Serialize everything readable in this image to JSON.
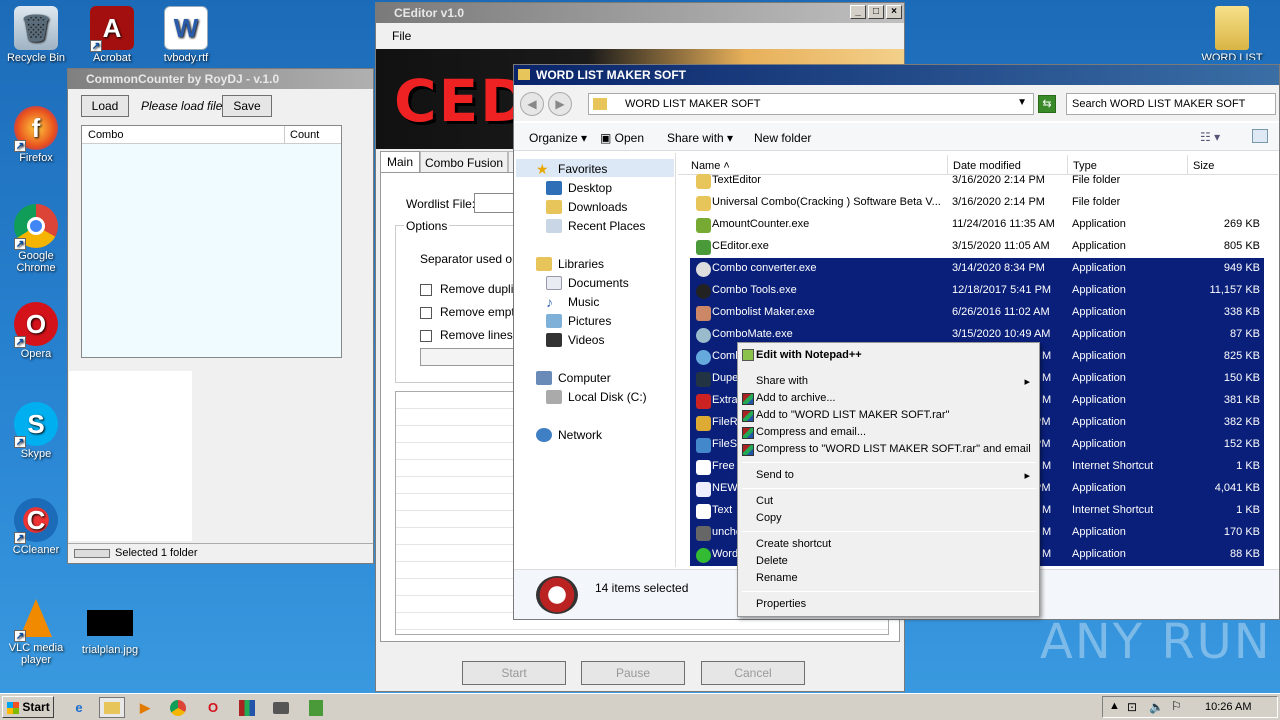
{
  "desktop": {
    "icons": [
      {
        "label": "Recycle Bin"
      },
      {
        "label": "Acrobat"
      },
      {
        "label": "tvbody.rtf"
      },
      {
        "label": "Firefox"
      },
      {
        "label": "Google Chrome"
      },
      {
        "label": "Opera"
      },
      {
        "label": "Skype"
      },
      {
        "label": "CCleaner"
      },
      {
        "label": "VLC media player"
      },
      {
        "label": "trialplan.jpg"
      },
      {
        "label": "WORD LIST ..."
      }
    ],
    "watermark": "ANY RUN"
  },
  "common_counter": {
    "title": "CommonCounter by RoyDJ - v.1.0",
    "load_label": "Load",
    "status_text": "Please load file",
    "save_label": "Save",
    "columns": [
      "Combo",
      "Count"
    ],
    "statusbar": "Selected 1 folder"
  },
  "ceditor": {
    "title": "CEditor v1.0",
    "menu_file": "File",
    "banner_text": "CED",
    "tabs": [
      "Main",
      "Combo Fusion",
      "D"
    ],
    "wordlist_label": "Wordlist File:",
    "options_label": "Options",
    "separator_label": "Separator used on c",
    "checks": [
      "Remove duplica",
      "Remove empty",
      "Remove lines w"
    ],
    "start_label": "Start",
    "pause_label": "Pause",
    "cancel_label": "Cancel"
  },
  "explorer": {
    "title": "WORD LIST MAKER SOFT",
    "address": "WORD LIST MAKER SOFT",
    "search_placeholder": "Search WORD LIST MAKER SOFT",
    "toolbar": {
      "organize": "Organize",
      "open": "Open",
      "share_with": "Share with",
      "new_folder": "New folder"
    },
    "nav": {
      "favorites": "Favorites",
      "desktop": "Desktop",
      "downloads": "Downloads",
      "recent": "Recent Places",
      "libraries": "Libraries",
      "documents": "Documents",
      "music": "Music",
      "pictures": "Pictures",
      "videos": "Videos",
      "computer": "Computer",
      "local_disk": "Local Disk (C:)",
      "network": "Network"
    },
    "columns": {
      "name": "Name",
      "date": "Date modified",
      "type": "Type",
      "size": "Size"
    },
    "files": [
      {
        "name": "TextEditor",
        "date": "3/16/2020 2:14 PM",
        "type": "File folder",
        "size": ""
      },
      {
        "name": "Universal Combo(Cracking ) Software Beta V...",
        "date": "3/16/2020 2:14 PM",
        "type": "File folder",
        "size": ""
      },
      {
        "name": "AmountCounter.exe",
        "date": "11/24/2016 11:35 AM",
        "type": "Application",
        "size": "269 KB"
      },
      {
        "name": "CEditor.exe",
        "date": "3/15/2020 11:05 AM",
        "type": "Application",
        "size": "805 KB"
      },
      {
        "name": "Combo converter.exe",
        "date": "3/14/2020 8:34 PM",
        "type": "Application",
        "size": "949 KB"
      },
      {
        "name": "Combo Tools.exe",
        "date": "12/18/2017 5:41 PM",
        "type": "Application",
        "size": "11,157 KB"
      },
      {
        "name": "Combolist Maker.exe",
        "date": "6/26/2016 11:02 AM",
        "type": "Application",
        "size": "338 KB"
      },
      {
        "name": "ComboMate.exe",
        "date": "3/15/2020 10:49 AM",
        "type": "Application",
        "size": "87 KB"
      },
      {
        "name": "Comb",
        "date": "M",
        "type": "Application",
        "size": "825 KB"
      },
      {
        "name": "Dupe",
        "date": "M",
        "type": "Application",
        "size": "150 KB"
      },
      {
        "name": "Extra",
        "date": "M",
        "type": "Application",
        "size": "381 KB"
      },
      {
        "name": "FileR",
        "date": "PM",
        "type": "Application",
        "size": "382 KB"
      },
      {
        "name": "FileSp",
        "date": "PM",
        "type": "Application",
        "size": "152 KB"
      },
      {
        "name": "Free",
        "date": "M",
        "type": "Internet Shortcut",
        "size": "1 KB"
      },
      {
        "name": "NEW",
        "date": "PM",
        "type": "Application",
        "size": "4,041 KB"
      },
      {
        "name": "Text",
        "date": "M",
        "type": "Internet Shortcut",
        "size": "1 KB"
      },
      {
        "name": "unche",
        "date": "M",
        "type": "Application",
        "size": "170 KB"
      },
      {
        "name": "Word",
        "date": "M",
        "type": "Application",
        "size": "88 KB"
      }
    ],
    "status": "14 items selected"
  },
  "context_menu": {
    "edit_notepad": "Edit with Notepad++",
    "share_with": "Share with",
    "add_archive": "Add to archive...",
    "add_rar": "Add to \"WORD LIST MAKER SOFT.rar\"",
    "compress_email": "Compress and email...",
    "compress_rar_email": "Compress to \"WORD LIST MAKER SOFT.rar\" and email",
    "send_to": "Send to",
    "cut": "Cut",
    "copy": "Copy",
    "create_shortcut": "Create shortcut",
    "delete": "Delete",
    "rename": "Rename",
    "properties": "Properties"
  },
  "taskbar": {
    "start": "Start",
    "clock": "10:26 AM"
  }
}
